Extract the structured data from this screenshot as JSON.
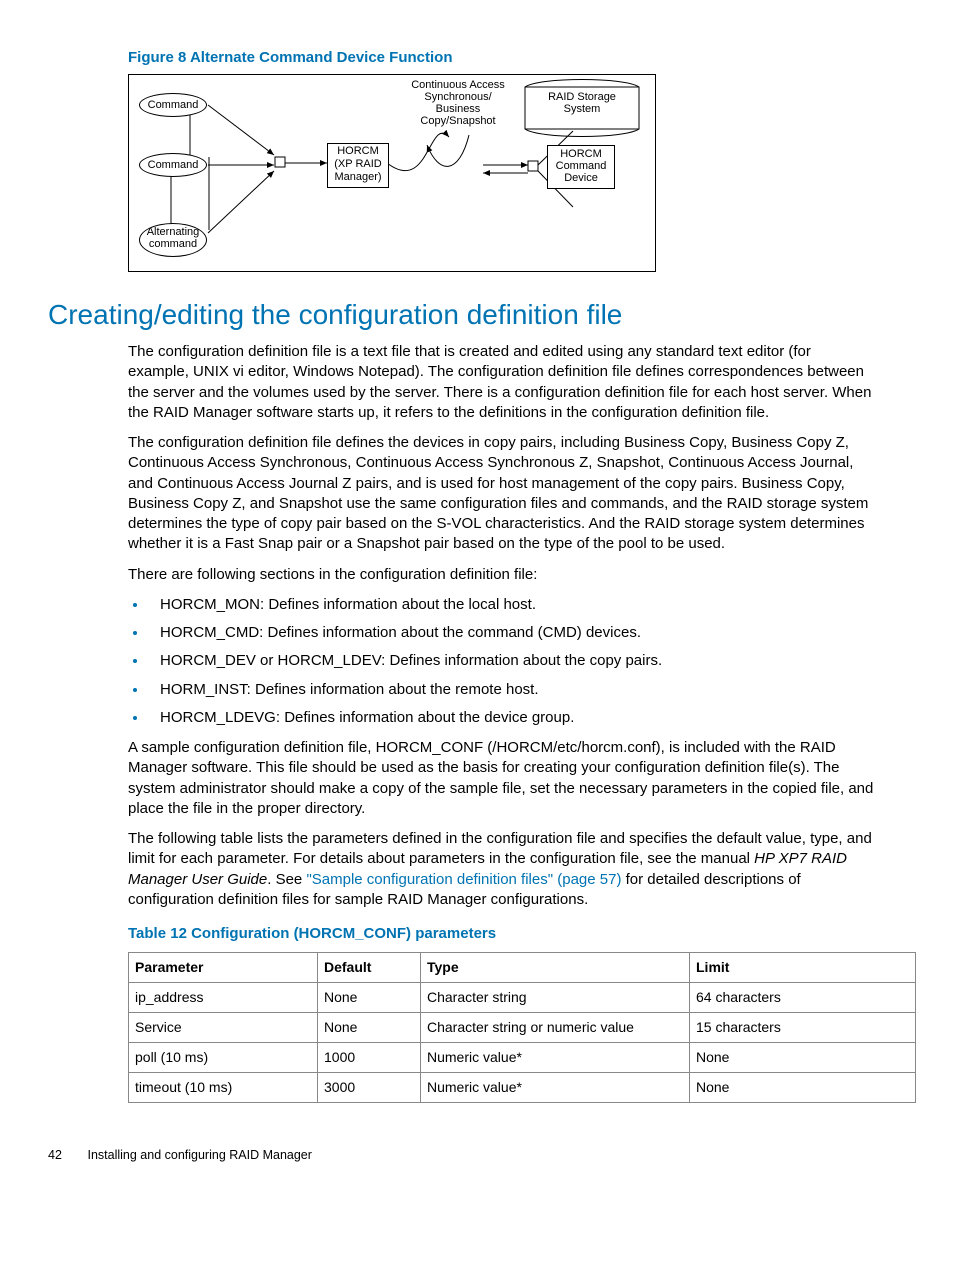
{
  "figure": {
    "caption": "Figure 8 Alternate Command Device Function",
    "nodes": {
      "cmd1": "Command",
      "cmd2": "Command",
      "alt": "Alternating command",
      "horcm": "HORCM (XP RAID Manager)",
      "top_label": "Continuous Access Synchronous/ Business Copy/Snapshot",
      "raid_label": "RAID Storage System",
      "horcm_dev": "HORCM Command Device"
    }
  },
  "heading": "Creating/editing the configuration definition file",
  "para1": "The configuration definition file is a text file that is created and edited using any standard text editor (for example, UNIX vi editor, Windows Notepad). The configuration definition file defines correspondences between the server and the volumes used by the server. There is a configuration definition file for each host server. When the RAID Manager software starts up, it refers to the definitions in the configuration definition file.",
  "para2": "The configuration definition file defines the devices in copy pairs, including Business Copy, Business Copy Z, Continuous Access Synchronous, Continuous Access Synchronous Z, Snapshot, Continuous Access Journal, and Continuous Access Journal Z pairs, and is used for host management of the copy pairs. Business Copy, Business Copy Z, and Snapshot use the same configuration files and commands, and the RAID storage system determines the type of copy pair based on the S-VOL characteristics. And the RAID storage system determines whether it is a Fast Snap pair or a Snapshot pair based on the type of the pool to be used.",
  "para3": "There are following sections in the configuration definition file:",
  "sections": [
    "HORCM_MON: Defines information about the local host.",
    "HORCM_CMD: Defines information about the command (CMD) devices.",
    "HORCM_DEV or HORCM_LDEV: Defines information about the copy pairs.",
    "HORM_INST: Defines information about the remote host.",
    "HORCM_LDEVG: Defines information about the device group."
  ],
  "para4": "A sample configuration definition file, HORCM_CONF (/HORCM/etc/horcm.conf), is included with the RAID Manager software. This file should be used as the basis for creating your configuration definition file(s). The system administrator should make a copy of the sample file, set the necessary parameters in the copied file, and place the file in the proper directory.",
  "para5a": "The following table lists the parameters defined in the configuration file and specifies the default value, type, and limit for each parameter. For details about parameters in the configuration file, see the manual ",
  "para5_manual": "HP XP7 RAID Manager User Guide",
  "para5_see": ". See ",
  "para5_link": "\"Sample configuration definition files\" (page 57)",
  "para5b": " for detailed descriptions of configuration definition files for sample RAID Manager configurations.",
  "table": {
    "caption": "Table 12 Configuration (HORCM_CONF) parameters",
    "headers": {
      "c1": "Parameter",
      "c2": "Default",
      "c3": "Type",
      "c4": "Limit"
    },
    "rows": [
      {
        "c1": "ip_address",
        "c2": "None",
        "c3": "Character string",
        "c4": "64 characters"
      },
      {
        "c1": "Service",
        "c2": "None",
        "c3": "Character string or numeric value",
        "c4": "15 characters"
      },
      {
        "c1": "poll (10 ms)",
        "c2": "1000",
        "c3": "Numeric value*",
        "c4": "None"
      },
      {
        "c1": "timeout (10 ms)",
        "c2": "3000",
        "c3": "Numeric value*",
        "c4": "None"
      }
    ]
  },
  "footer": {
    "page": "42",
    "title": "Installing and configuring RAID Manager"
  }
}
